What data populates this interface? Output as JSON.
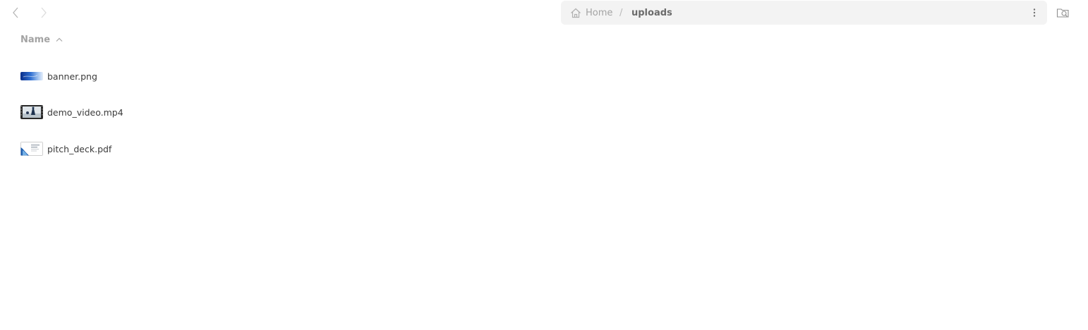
{
  "toolbar": {
    "back_icon": "chevron-left-icon",
    "forward_icon": "chevron-right-icon",
    "search_icon": "folder-search-icon",
    "menu_icon": "vertical-dots-icon"
  },
  "breadcrumb": {
    "home_label": "Home",
    "separator": "/",
    "current_label": "uploads"
  },
  "list": {
    "column_header": "Name",
    "sort_direction": "ascending",
    "files": [
      {
        "name": "banner.png",
        "type": "image"
      },
      {
        "name": "demo_video.mp4",
        "type": "video"
      },
      {
        "name": "pitch_deck.pdf",
        "type": "pdf"
      }
    ]
  },
  "colors": {
    "path_bar_bg": "#f3f3f3",
    "muted_text": "#a3a3a3",
    "text": "#3b3b3b"
  }
}
